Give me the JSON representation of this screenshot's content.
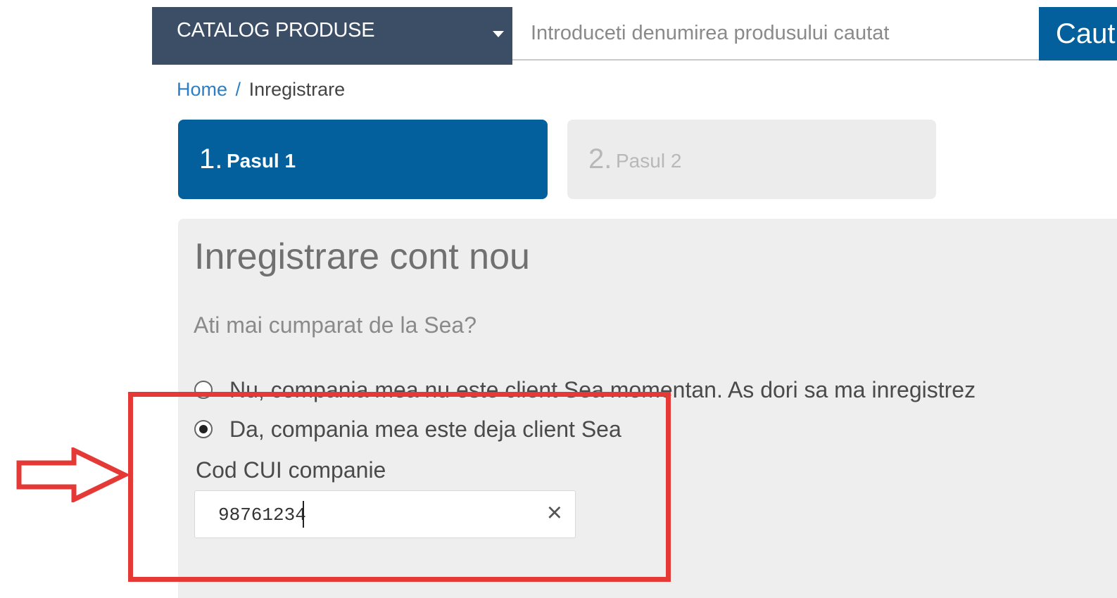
{
  "header": {
    "catalog_label": "CATALOG PRODUSE",
    "search_placeholder": "Introduceti denumirea produsului cautat",
    "search_button_label": "Caut"
  },
  "breadcrumb": {
    "home": "Home",
    "separator": "/",
    "current": "Inregistrare"
  },
  "steps": [
    {
      "number": "1.",
      "label": "Pasul 1",
      "active": true
    },
    {
      "number": "2.",
      "label": "Pasul 2",
      "active": false
    }
  ],
  "form": {
    "title": "Inregistrare cont nou",
    "question": "Ati mai cumparat de la Sea?",
    "options": [
      {
        "label": "Nu, compania mea nu este client Sea momentan. As dori sa ma inregistrez",
        "checked": false
      },
      {
        "label": "Da, compania mea este deja client Sea",
        "checked": true
      }
    ],
    "cui_label": "Cod CUI companie",
    "cui_value": "98761234",
    "clear_icon": "×"
  },
  "colors": {
    "header_dark": "#3c4e66",
    "brand_blue": "#03609c",
    "link_blue": "#2d7fc3",
    "annotation_red": "#e53935"
  },
  "icons": [
    "chevron-down-icon",
    "close-icon",
    "radio-icon",
    "arrow-right-icon"
  ]
}
